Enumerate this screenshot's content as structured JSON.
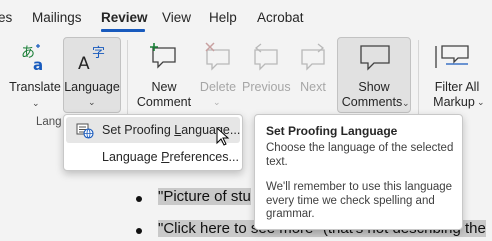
{
  "tabs": {
    "items": [
      {
        "label": "es"
      },
      {
        "label": "Mailings"
      },
      {
        "label": "Review"
      },
      {
        "label": "View"
      },
      {
        "label": "Help"
      },
      {
        "label": "Acrobat"
      }
    ],
    "active": "Review"
  },
  "ribbon": {
    "translate": {
      "label": "Translate",
      "icon": "translate-icon"
    },
    "language": {
      "label": "Language",
      "icon": "language-icon"
    },
    "new_comment": {
      "line1": "New",
      "line2": "Comment",
      "icon": "new-comment-icon"
    },
    "delete": {
      "label": "Delete",
      "icon": "delete-comment-icon"
    },
    "previous": {
      "label": "Previous",
      "icon": "previous-comment-icon"
    },
    "next": {
      "label": "Next",
      "icon": "next-comment-icon"
    },
    "show_comments": {
      "line1": "Show",
      "line2": "Comments",
      "icon": "show-comments-icon"
    },
    "filter": {
      "line1": "Filter All",
      "line2": "Markup",
      "icon": "filter-markup-icon"
    },
    "group_label": "Lang"
  },
  "language_menu": {
    "items": [
      {
        "label_before": "Set Proofing ",
        "label_underlined": "L",
        "label_after": "anguage...",
        "icon": "proofing-language-icon"
      },
      {
        "label_before": "Language ",
        "label_underlined": "P",
        "label_after": "references..."
      }
    ]
  },
  "tooltip": {
    "title": "Set Proofing Language",
    "desc": "Choose the language of the selected text.",
    "note": "We'll remember to use this language every time we check spelling and grammar."
  },
  "document": {
    "line1": "\"Picture of stu",
    "line2_highlighted": "\"Click here to see more\" (that's not describing the"
  },
  "colors": {
    "accent": "#185abd",
    "background": "#f3f3f3"
  }
}
